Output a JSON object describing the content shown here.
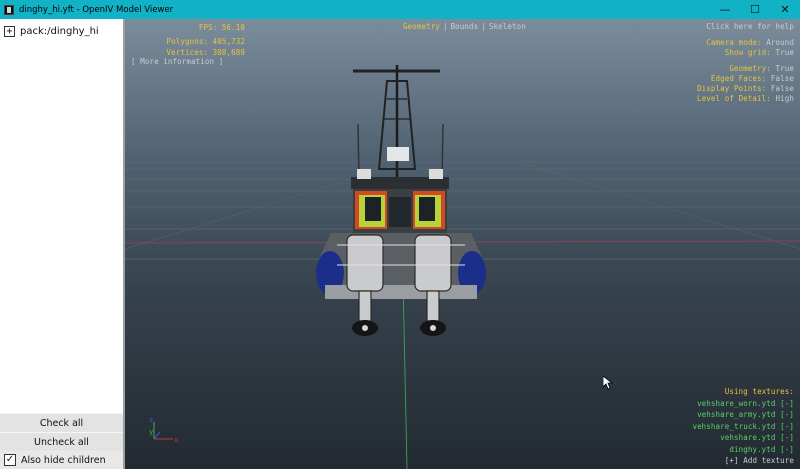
{
  "window": {
    "title": "dinghy_hi.yft - OpenIV Model Viewer",
    "buttons": {
      "minimize": "—",
      "maximize": "☐",
      "close": "✕"
    }
  },
  "tree": {
    "expander": "+",
    "root_label": "pack:/dinghy_hi"
  },
  "side_buttons": {
    "check_all": "Check all",
    "uncheck_all": "Uncheck all",
    "also_hide_children": "Also hide children",
    "also_hide_children_checked": true
  },
  "overlay": {
    "fps": "FPS: 56.10",
    "polygons": "Polygons: 405,732",
    "vertices": "Vertices: 308,689",
    "more_info": "[ More information ]",
    "tabs": [
      "Geometry",
      "Bounds",
      "Skeleton"
    ],
    "tab_separator": "|",
    "active_tab": "Geometry",
    "help": "Click here for help",
    "camera_mode_label": "Camera mode:",
    "camera_mode_value": "Around",
    "show_grid_label": "Show grid:",
    "show_grid_value": "True",
    "geometry_label": "Geometry:",
    "geometry_value": "True",
    "edged_faces_label": "Edged Faces:",
    "edged_faces_value": "False",
    "display_points_label": "Display Points:",
    "display_points_value": "False",
    "lod_label": "Level of Detail:",
    "lod_value": "High",
    "using_textures": "Using textures:",
    "textures": [
      "vehshare_worn.ytd [-]",
      "vehshare_army.ytd [-]",
      "vehshare_truck.ytd [-]",
      "vehshare.ytd [-]",
      "dinghy.ytd [-]"
    ],
    "add_texture": "[+] Add texture"
  },
  "axis_labels": {
    "x": "x",
    "y": "y",
    "z": "z"
  },
  "colors": {
    "titlebar": "#11b2c6",
    "overlay_yellow": "#e8c33c",
    "overlay_green": "#5ad06a",
    "overlay_grey": "#c7ccd1"
  }
}
